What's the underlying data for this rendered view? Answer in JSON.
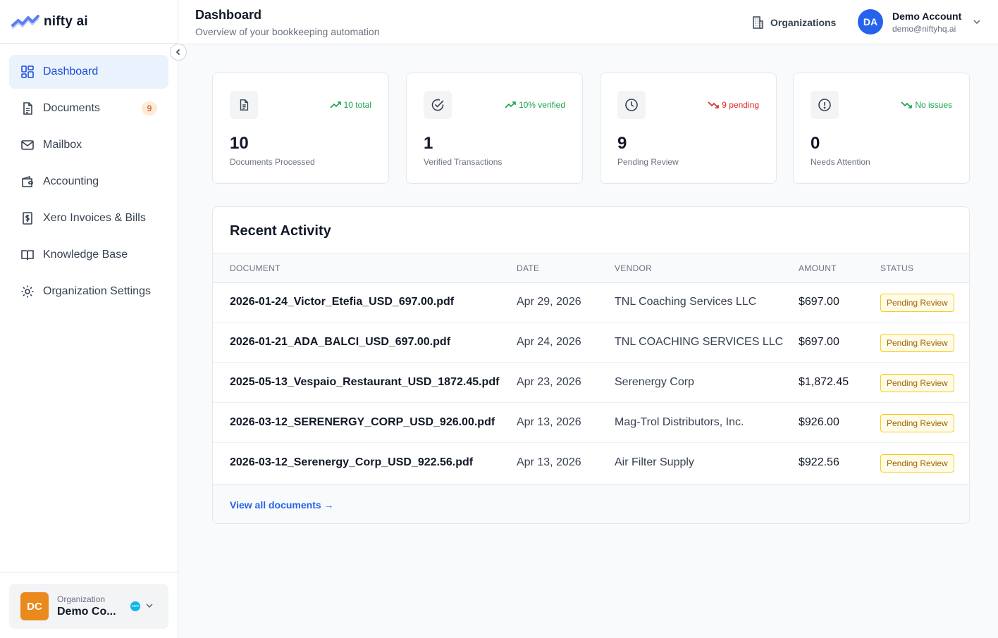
{
  "brand": {
    "name": "nifty ai"
  },
  "sidebar": {
    "items": [
      {
        "label": "Dashboard",
        "icon": "dashboard-icon",
        "active": true
      },
      {
        "label": "Documents",
        "icon": "document-icon",
        "badge": "9"
      },
      {
        "label": "Mailbox",
        "icon": "mail-icon"
      },
      {
        "label": "Accounting",
        "icon": "wallet-icon"
      },
      {
        "label": "Xero Invoices & Bills",
        "icon": "dollar-receipt-icon"
      },
      {
        "label": "Knowledge Base",
        "icon": "book-icon"
      },
      {
        "label": "Organization Settings",
        "icon": "gear-icon"
      }
    ],
    "org": {
      "initials": "DC",
      "label": "Organization",
      "name": "Demo Co...",
      "integration_badge": "xero"
    }
  },
  "header": {
    "title": "Dashboard",
    "subtitle": "Overview of your bookkeeping automation",
    "orgs_label": "Organizations",
    "account": {
      "initials": "DA",
      "name": "Demo Account",
      "email": "demo@niftyhq.ai"
    }
  },
  "stats": [
    {
      "value": "10",
      "label": "Documents Processed",
      "trend": "10 total",
      "trend_dir": "up",
      "icon": "file-text-icon"
    },
    {
      "value": "1",
      "label": "Verified Transactions",
      "trend": "10% verified",
      "trend_dir": "up",
      "icon": "check-circle-icon"
    },
    {
      "value": "9",
      "label": "Pending Review",
      "trend": "9 pending",
      "trend_dir": "down-red",
      "icon": "clock-icon"
    },
    {
      "value": "0",
      "label": "Needs Attention",
      "trend": "No issues",
      "trend_dir": "down-green",
      "icon": "alert-circle-icon"
    }
  ],
  "activity": {
    "title": "Recent Activity",
    "columns": [
      "DOCUMENT",
      "DATE",
      "VENDOR",
      "AMOUNT",
      "STATUS"
    ],
    "rows": [
      {
        "document": "2026-01-24_Victor_Etefia_USD_697.00.pdf",
        "date": "Apr 29, 2026",
        "vendor": "TNL Coaching Services LLC",
        "amount": "$697.00",
        "status": "Pending Review"
      },
      {
        "document": "2026-01-21_ADA_BALCI_USD_697.00.pdf",
        "date": "Apr 24, 2026",
        "vendor": "TNL COACHING SERVICES LLC",
        "amount": "$697.00",
        "status": "Pending Review"
      },
      {
        "document": "2025-05-13_Vespaio_Restaurant_USD_1872.45.pdf",
        "date": "Apr 23, 2026",
        "vendor": "Serenergy Corp",
        "amount": "$1,872.45",
        "status": "Pending Review"
      },
      {
        "document": "2026-03-12_SERENERGY_CORP_USD_926.00.pdf",
        "date": "Apr 13, 2026",
        "vendor": "Mag-Trol Distributors, Inc.",
        "amount": "$926.00",
        "status": "Pending Review"
      },
      {
        "document": "2026-03-12_Serenergy_Corp_USD_922.56.pdf",
        "date": "Apr 13, 2026",
        "vendor": "Air Filter Supply",
        "amount": "$922.56",
        "status": "Pending Review"
      }
    ],
    "view_all": "View all documents →"
  },
  "colors": {
    "accent": "#2563eb",
    "active_bg": "#eaf2fd",
    "org_avatar": "#ea8a1c",
    "pending_border": "#facc15",
    "trend_up": "#16a34a",
    "trend_down": "#dc2626"
  }
}
